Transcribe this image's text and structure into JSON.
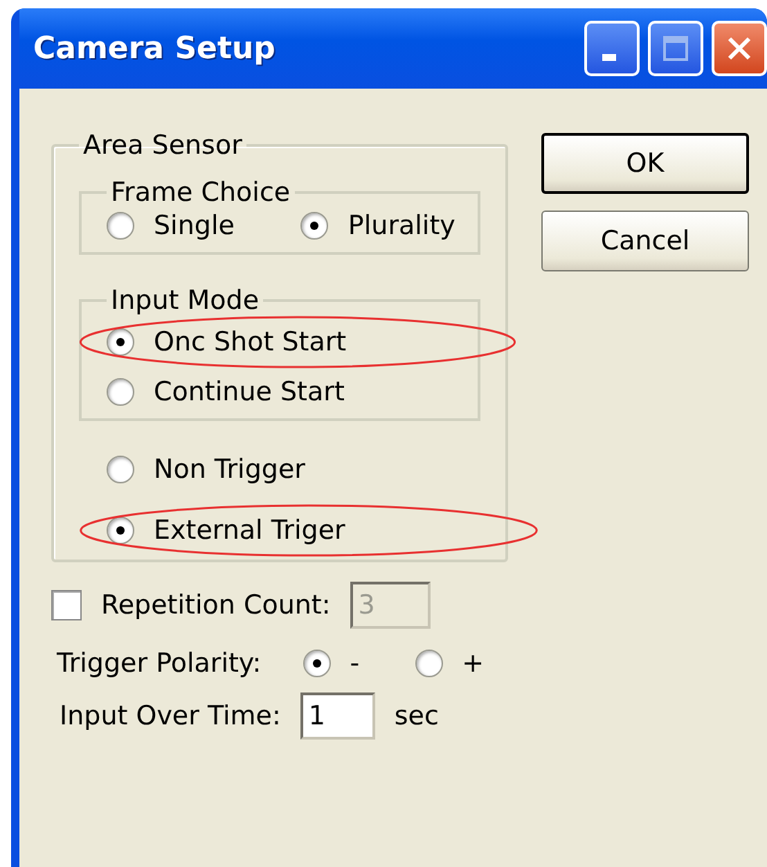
{
  "window": {
    "title": "Camera Setup"
  },
  "area_sensor": {
    "title": "Area Sensor",
    "frame_choice": {
      "title": "Frame Choice",
      "options": [
        {
          "label": "Single",
          "selected": false
        },
        {
          "label": "Plurality",
          "selected": true
        }
      ]
    },
    "input_mode": {
      "title": "Input Mode",
      "options": [
        {
          "label": "Onc Shot Start",
          "selected": true,
          "highlighted": true
        },
        {
          "label": "Continue Start",
          "selected": false,
          "highlighted": false
        }
      ]
    },
    "trigger_options": [
      {
        "label": "Non Trigger",
        "selected": false,
        "highlighted": false
      },
      {
        "label": "External Triger",
        "selected": true,
        "highlighted": true
      }
    ]
  },
  "buttons": [
    {
      "label": "OK",
      "default": true
    },
    {
      "label": "Cancel",
      "default": false
    }
  ],
  "repetition": {
    "label": "Repetition Count:",
    "checked": false,
    "value": "3",
    "disabled": true
  },
  "trigger_polarity": {
    "label": "Trigger Polarity:",
    "options": [
      {
        "label": "-",
        "selected": true
      },
      {
        "label": "+",
        "selected": false
      }
    ]
  },
  "input_over_time": {
    "label": "Input Over Time:",
    "value": "1",
    "unit": "sec"
  }
}
